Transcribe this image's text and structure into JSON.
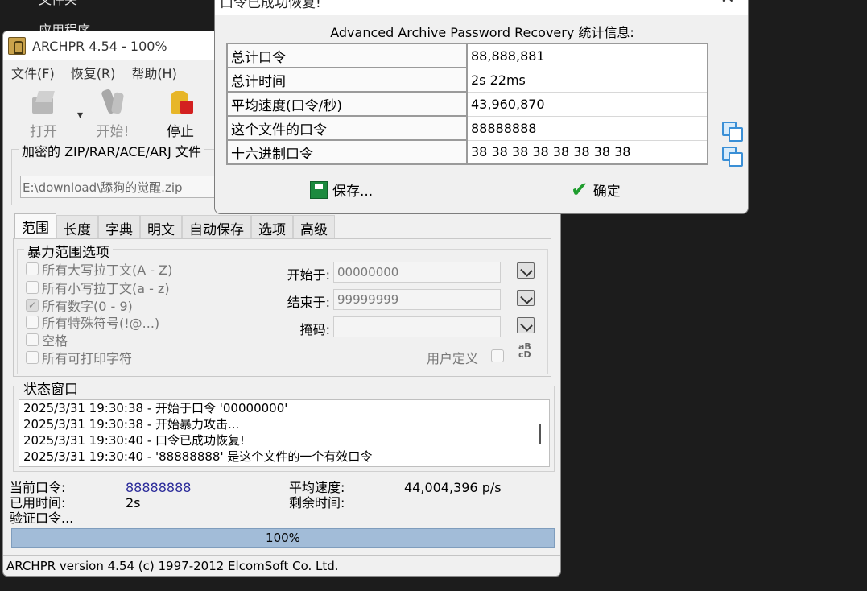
{
  "background": {
    "label_top": "文件夹",
    "label_apps": "应用程序"
  },
  "main": {
    "title": "ARCHPR 4.54 - 100%",
    "menu": [
      "文件(F)",
      "恢复(R)",
      "帮助(H)"
    ],
    "toolbar": {
      "open": "打开",
      "start": "开始!",
      "stop": "停止"
    },
    "file_group_title": "加密的 ZIP/RAR/ACE/ARJ 文件",
    "file_path": "E:\\download\\舔狗的觉醒.zip",
    "tabs": [
      "范围",
      "长度",
      "字典",
      "明文",
      "自动保存",
      "选项",
      "高级"
    ],
    "brute": {
      "title": "暴力范围选项",
      "options": [
        {
          "label": "所有大写拉丁文(A - Z)",
          "checked": false
        },
        {
          "label": "所有小写拉丁文(a - z)",
          "checked": false
        },
        {
          "label": "所有数字(0 - 9)",
          "checked": true
        },
        {
          "label": "所有特殊符号(!@...)",
          "checked": false
        },
        {
          "label": "空格",
          "checked": false
        },
        {
          "label": "所有可打印字符",
          "checked": false
        }
      ],
      "start_label": "开始于:",
      "start_value": "00000000",
      "end_label": "结束于:",
      "end_value": "99999999",
      "mask_label": "掩码:",
      "mask_value": "",
      "user_defined": "用户定义",
      "abc_icon_text": "aBcD"
    },
    "status": {
      "title": "状态窗口",
      "log": [
        "2025/3/31 19:30:38 - 开始于口令 '00000000'",
        "2025/3/31 19:30:38 - 开始暴力攻击...",
        "2025/3/31 19:30:40 - 口令已成功恢复!",
        "2025/3/31 19:30:40 - '88888888' 是这个文件的一个有效口令"
      ]
    },
    "info": {
      "current_label": "当前口令:",
      "current_value": "88888888",
      "elapsed_label": "已用时间:",
      "elapsed_value": "2s",
      "verify_label": "验证口令...",
      "avg_label": "平均速度:",
      "avg_value": "44,004,396 p/s",
      "remaining_label": "剩余时间:"
    },
    "progress": {
      "text": "100%",
      "value": 100
    },
    "statusbar": "ARCHPR version 4.54 (c) 1997-2012 ElcomSoft Co. Ltd."
  },
  "dialog": {
    "title": "口令已成功恢复!",
    "header": "Advanced Archive Password Recovery 统计信息:",
    "rows": [
      {
        "label": "总计口令",
        "value": "88,888,881"
      },
      {
        "label": "总计时间",
        "value": "2s 22ms"
      },
      {
        "label": "平均速度(口令/秒)",
        "value": "43,960,870"
      },
      {
        "label": "这个文件的口令",
        "value": "88888888"
      },
      {
        "label": "十六进制口令",
        "value": "38 38 38 38 38 38 38 38"
      }
    ],
    "save": "保存...",
    "ok": "确定"
  }
}
